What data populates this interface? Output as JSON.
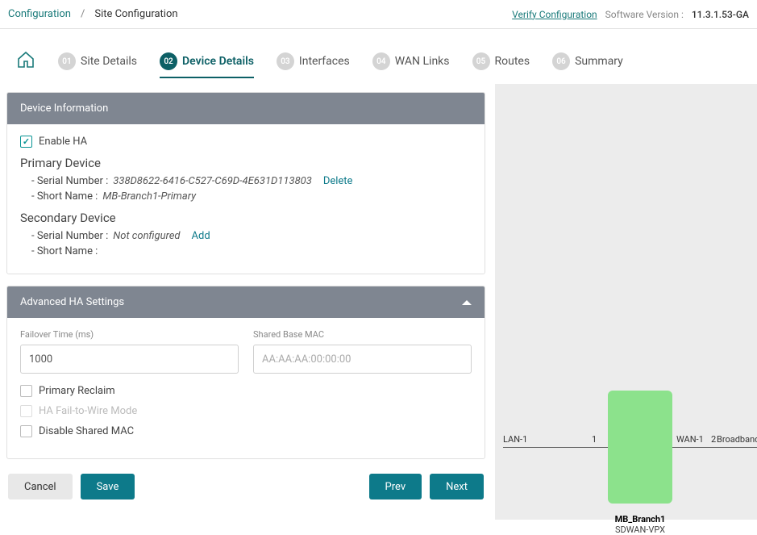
{
  "topbar": {
    "breadcrumb_root": "Configuration",
    "breadcrumb_sep": "/",
    "breadcrumb_current": "Site Configuration",
    "verify": "Verify Configuration",
    "sw_label": "Software Version :",
    "sw_value": "11.3.1.53-GA"
  },
  "tabs": {
    "t1": {
      "num": "01",
      "label": "Site Details"
    },
    "t2": {
      "num": "02",
      "label": "Device Details"
    },
    "t3": {
      "num": "03",
      "label": "Interfaces"
    },
    "t4": {
      "num": "04",
      "label": "WAN Links"
    },
    "t5": {
      "num": "05",
      "label": "Routes"
    },
    "t6": {
      "num": "06",
      "label": "Summary"
    }
  },
  "deviceInfo": {
    "header": "Device Information",
    "enable_ha": "Enable HA",
    "primary_title": "Primary Device",
    "primary_serial_label": "Serial Number :",
    "primary_serial_value": "338D8622-6416-C527-C69D-4E631D113803",
    "primary_serial_action": "Delete",
    "primary_short_label": "Short Name :",
    "primary_short_value": "MB-Branch1-Primary",
    "secondary_title": "Secondary Device",
    "secondary_serial_label": "Serial Number :",
    "secondary_serial_value": "Not configured",
    "secondary_serial_action": "Add",
    "secondary_short_label": "Short Name :",
    "secondary_short_value": ""
  },
  "advanced": {
    "header": "Advanced HA Settings",
    "failover_label": "Failover Time (ms)",
    "failover_value": "1000",
    "mac_label": "Shared Base MAC",
    "mac_placeholder": "AA:AA:AA:00:00:00",
    "primary_reclaim": "Primary Reclaim",
    "fail_to_wire": "HA Fail-to-Wire Mode",
    "disable_mac": "Disable Shared MAC"
  },
  "buttons": {
    "cancel": "Cancel",
    "save": "Save",
    "prev": "Prev",
    "next": "Next"
  },
  "diagram": {
    "lan": "LAN-1",
    "lan_port": "1",
    "wan": "WAN-1",
    "wan_port": "2",
    "broadband": "Broadband-Verizon",
    "name": "MB_Branch1",
    "type": "SDWAN-VPX"
  }
}
